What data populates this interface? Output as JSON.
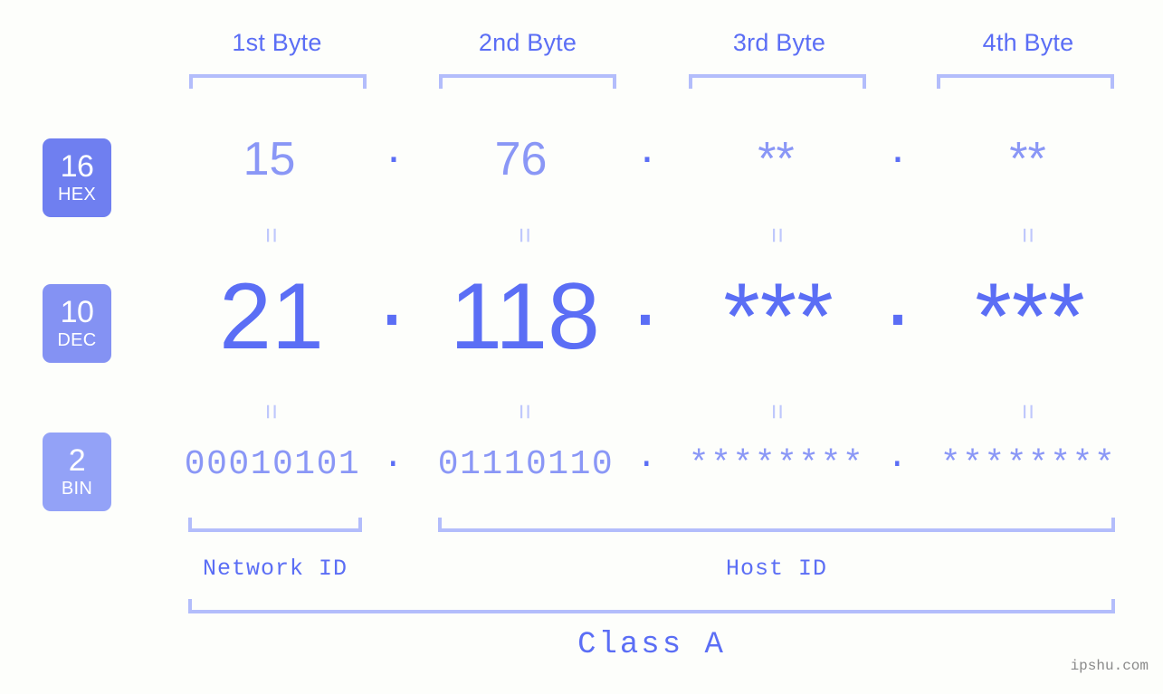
{
  "header": {
    "byte_labels": [
      "1st Byte",
      "2nd Byte",
      "3rd Byte",
      "4th Byte"
    ]
  },
  "bases": [
    {
      "id": "hex",
      "number": "16",
      "name": "HEX",
      "color": "#6f7ff0"
    },
    {
      "id": "dec",
      "number": "10",
      "name": "DEC",
      "color": "#8492f3"
    },
    {
      "id": "bin",
      "number": "2",
      "name": "BIN",
      "color": "#93a2f7"
    }
  ],
  "rows": {
    "hex": {
      "bytes": [
        "15",
        "76",
        "**",
        "**"
      ],
      "separator": "."
    },
    "dec": {
      "bytes": [
        "21",
        "118",
        "***",
        "***"
      ],
      "separator": "."
    },
    "bin": {
      "bytes": [
        "00010101",
        "01110110",
        "********",
        "********"
      ],
      "separator": "."
    }
  },
  "equals": {
    "symbol": "="
  },
  "footer": {
    "network_id_label": "Network ID",
    "host_id_label": "Host ID",
    "class_label": "Class A"
  },
  "watermark": {
    "text": "ipshu.com"
  },
  "colors": {
    "background": "#fdfefb",
    "accent_strong": "#5b6ef5",
    "accent_mid": "#8a97f6",
    "accent_light": "#b3bdfb",
    "equals": "#bfc8fc",
    "watermark": "#8a8a8a"
  }
}
